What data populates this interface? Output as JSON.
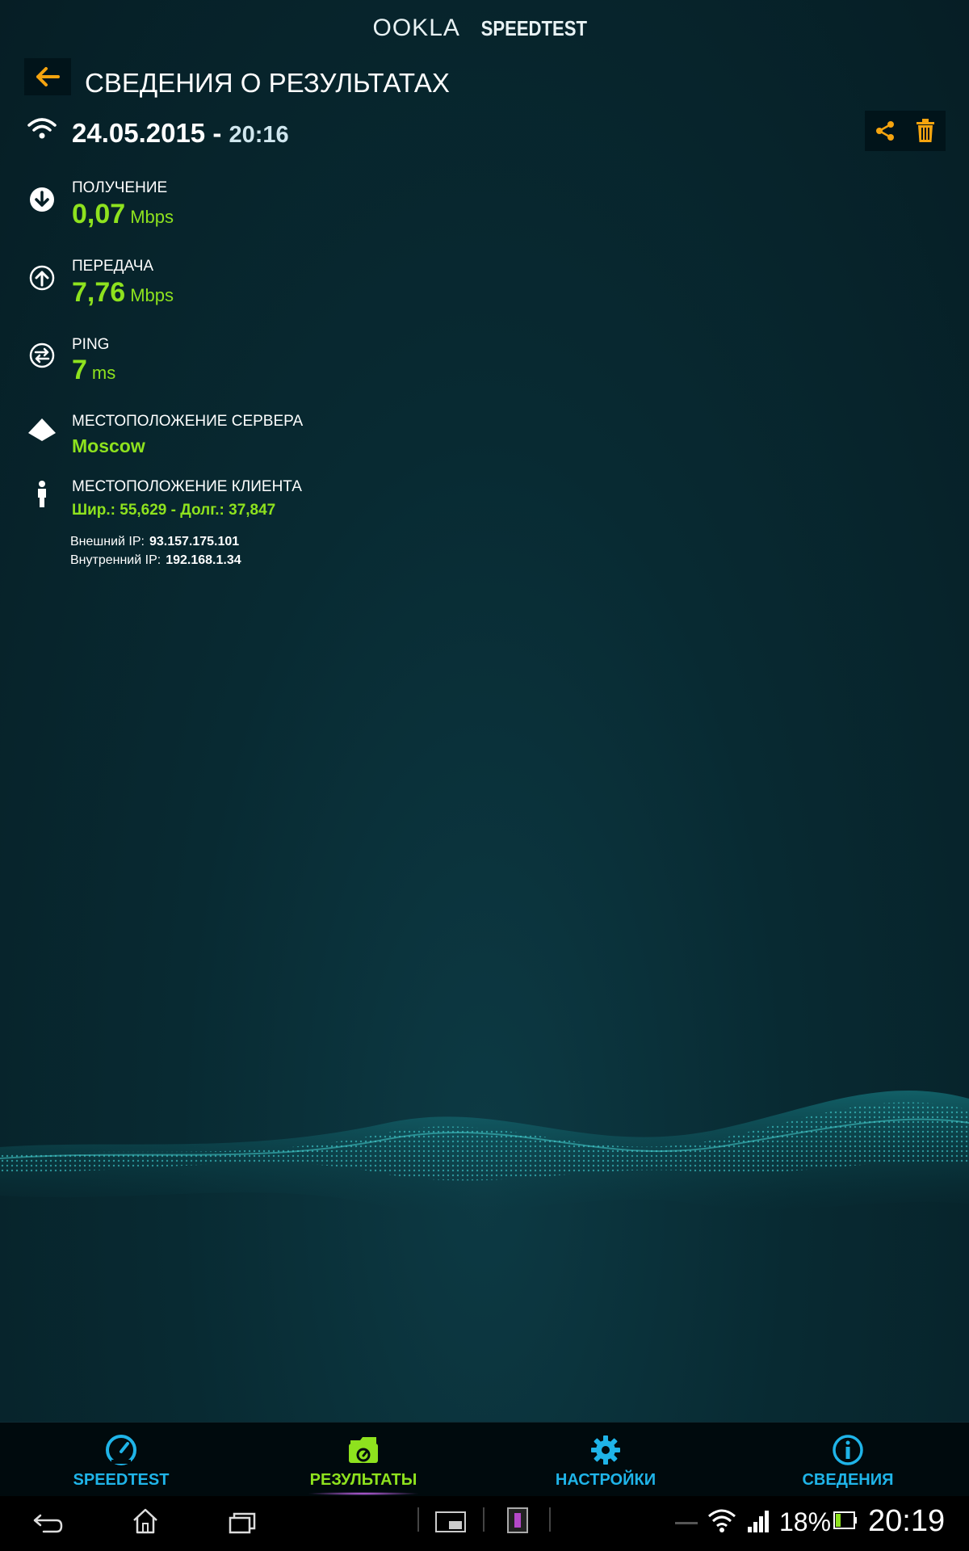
{
  "header": {
    "logo_left": "OOKLA",
    "logo_right": "SPEEDTEST",
    "title": "СВЕДЕНИЯ О РЕЗУЛЬТАТАХ"
  },
  "result": {
    "date": "24.05.2015 -",
    "time": "20:16",
    "download": {
      "label": "ПОЛУЧЕНИЕ",
      "value": "0,07",
      "unit": "Mbps"
    },
    "upload": {
      "label": "ПЕРЕДАЧА",
      "value": "7,76",
      "unit": "Mbps"
    },
    "ping": {
      "label": "PING",
      "value": "7",
      "unit": "ms"
    },
    "server": {
      "label": "МЕСТОПОЛОЖЕНИЕ СЕРВЕРА",
      "value": "Moscow"
    },
    "client": {
      "label": "МЕСТОПОЛОЖЕНИЕ КЛИЕНТА",
      "value": "Шир.: 55,629 - Долг.: 37,847"
    },
    "external_ip": {
      "label": "Внешний IP:",
      "value": "93.157.175.101"
    },
    "internal_ip": {
      "label": "Внутренний IP:",
      "value": "192.168.1.34"
    }
  },
  "nav": [
    {
      "label": "SPEEDTEST",
      "icon": "speedometer-icon",
      "color": "#1fb4e8",
      "active": false
    },
    {
      "label": "РЕЗУЛЬТАТЫ",
      "icon": "results-folder-icon",
      "color": "#8ee21e",
      "active": true
    },
    {
      "label": "НАСТРОЙКИ",
      "icon": "gear-icon",
      "color": "#1fb4e8",
      "active": false
    },
    {
      "label": "СВЕДЕНИЯ",
      "icon": "info-icon",
      "color": "#1fb4e8",
      "active": false
    }
  ],
  "status_bar": {
    "battery": "18%",
    "clock": "20:19"
  },
  "colors": {
    "accent_orange": "#f5a40f",
    "value_green": "#8ee21e",
    "nav_blue": "#1fb4e8"
  }
}
